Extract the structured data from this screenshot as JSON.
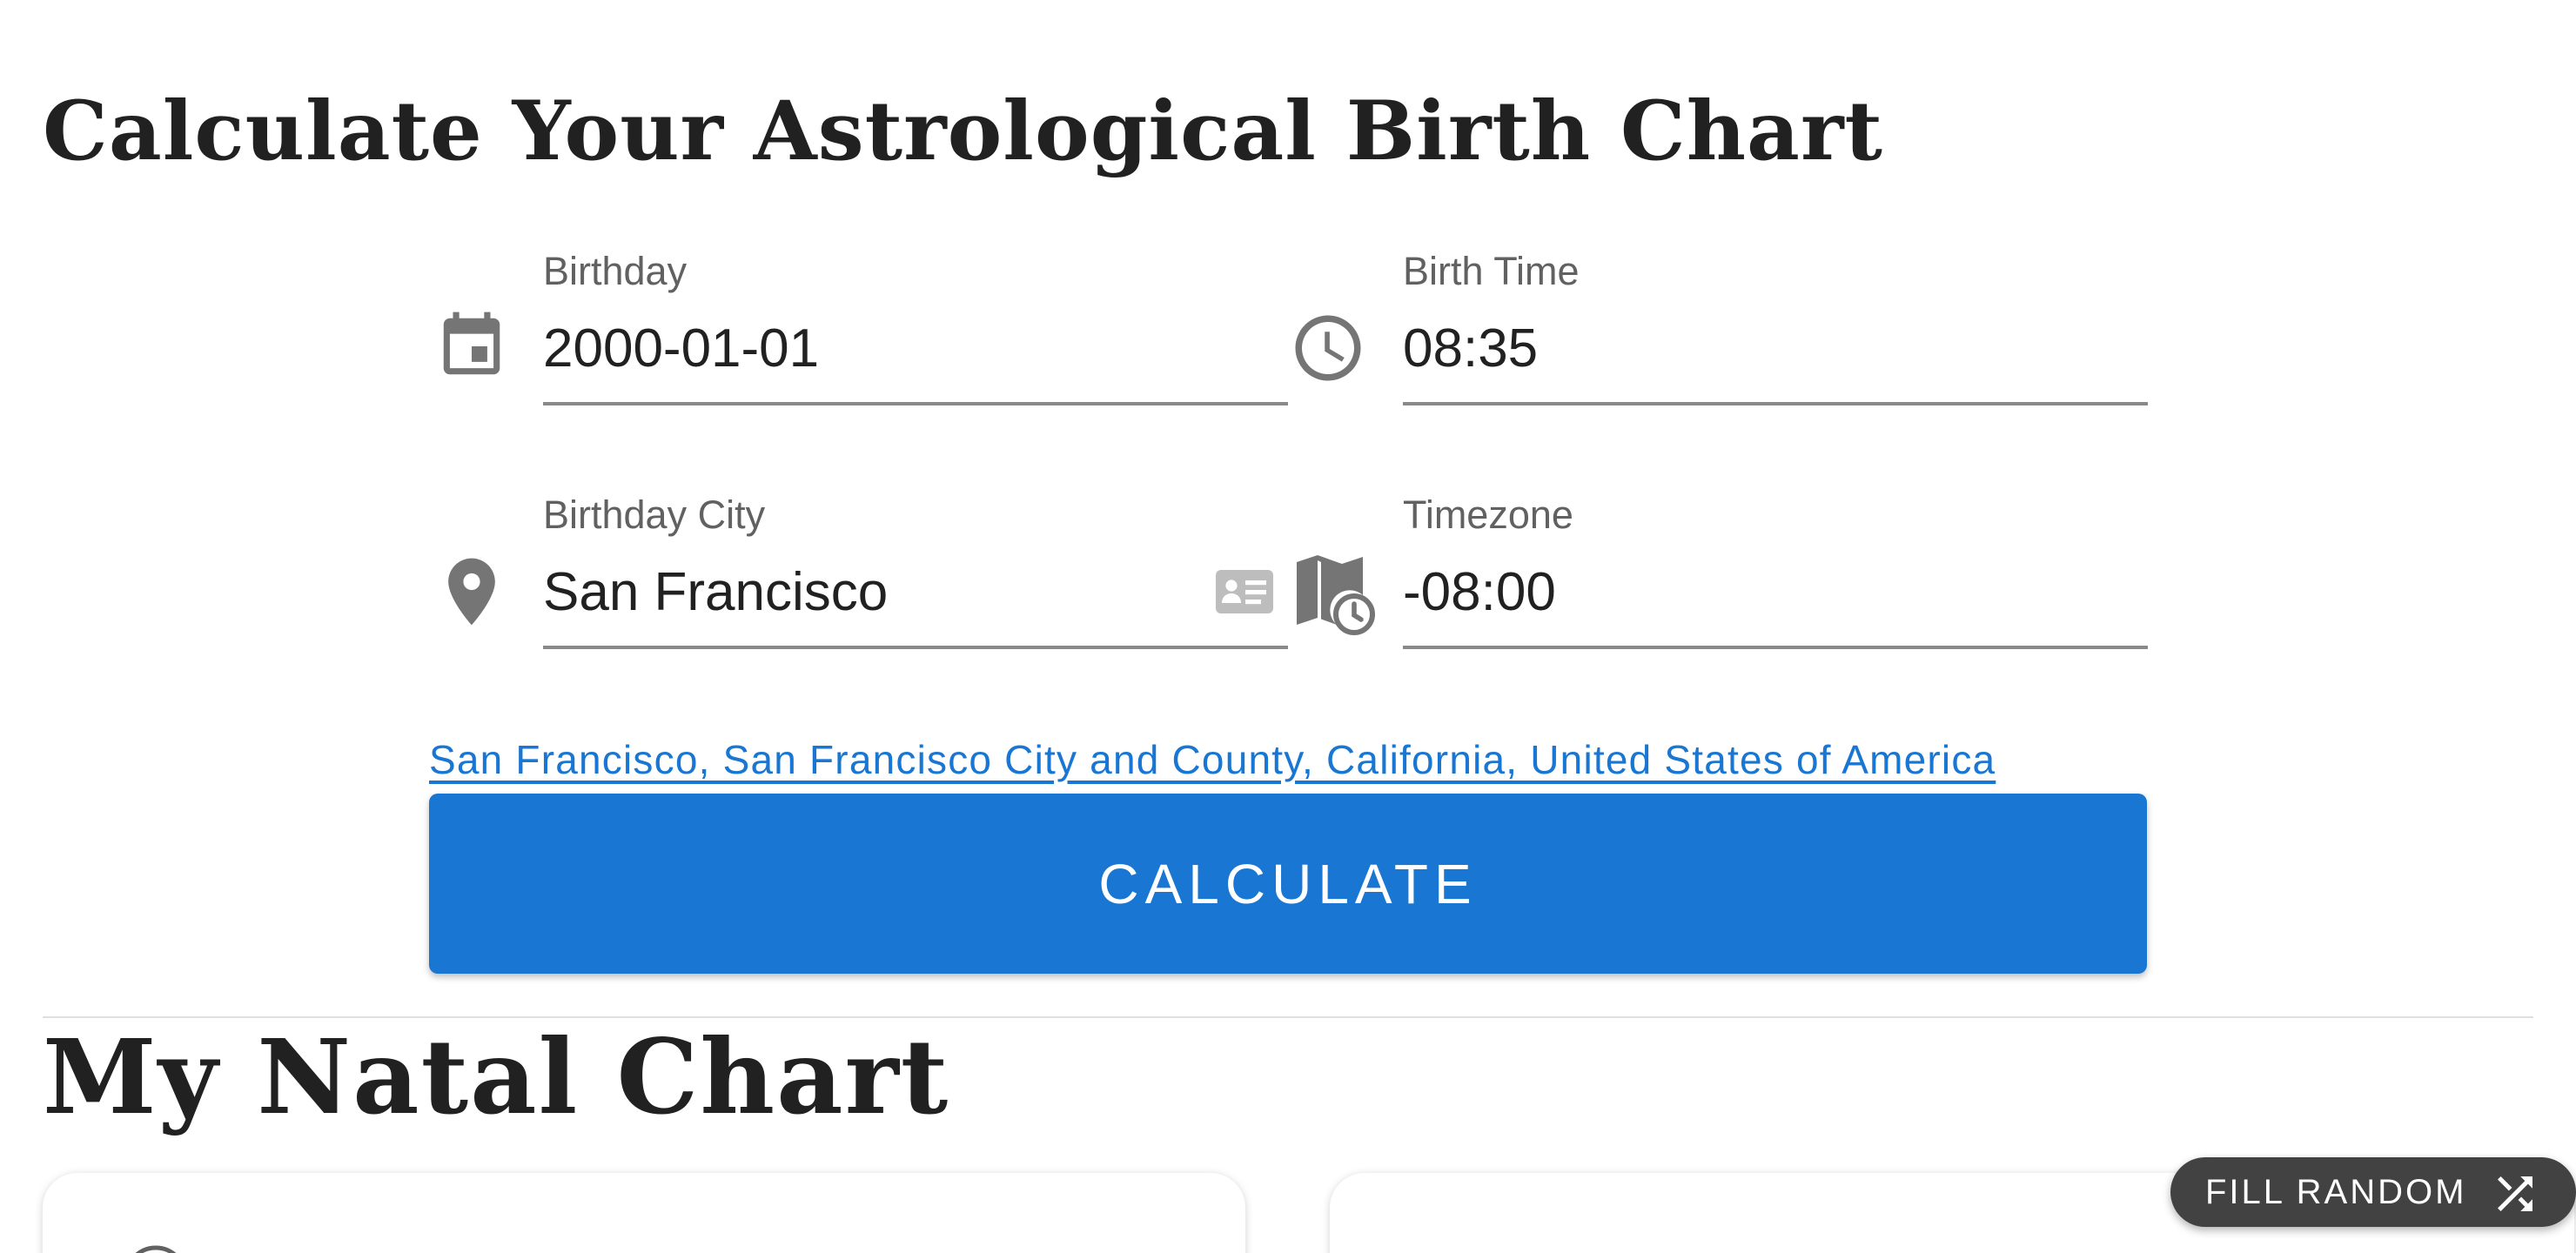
{
  "form_section": {
    "title": "Calculate Your Astrological Birth Chart",
    "birthday": {
      "label": "Birthday",
      "value": "2000-01-01"
    },
    "birth_time": {
      "label": "Birth Time",
      "value": "08:35"
    },
    "birthday_city": {
      "label": "Birthday City",
      "value": "San Francisco"
    },
    "timezone": {
      "label": "Timezone",
      "value": "-08:00"
    },
    "resolved_location": "San Francisco, San Francisco City and County, California, United States of America",
    "calculate_button": "CALCULATE"
  },
  "natal_section": {
    "title": "My Natal Chart"
  },
  "fab": {
    "label": "FILL RANDOM"
  },
  "colors": {
    "accent": "#1976d2",
    "icon": "#757575",
    "fab_bg": "#424242"
  },
  "icons": [
    "calendar-icon",
    "clock-icon",
    "location-pin-icon",
    "contact-card-icon",
    "map-timezone-icon",
    "shuffle-icon"
  ]
}
